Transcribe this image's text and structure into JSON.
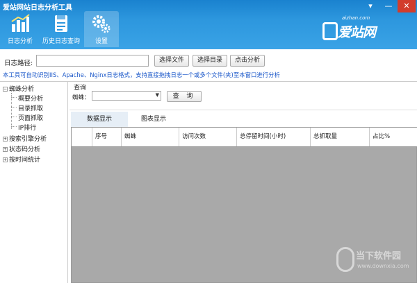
{
  "window": {
    "title": "爱站网站日志分析工具",
    "controls": {
      "menu": "▾",
      "minimize": "—",
      "close": "✕"
    }
  },
  "ribbon": {
    "tools": [
      {
        "label": "日志分析",
        "icon": "bar-chart-icon"
      },
      {
        "label": "历史日志查询",
        "icon": "document-icon"
      },
      {
        "label": "设置",
        "icon": "gears-icon"
      }
    ],
    "logo": {
      "url": "aizhan.com",
      "text": "爱站网"
    }
  },
  "path_bar": {
    "label": "日志路径:",
    "value": "",
    "buttons": {
      "select_file": "选择文件",
      "select_dir": "选择目录",
      "analyze": "点击分析"
    },
    "notice": "本工具可自动识别IIS、Apache、Nginx日志格式，支持直接拖拽日志一个或多个文件(夹)至本窗口进行分析"
  },
  "tree": {
    "root": "蜘蛛分析",
    "children": [
      "概要分析",
      "目录抓取",
      "页面抓取",
      "IP排行"
    ],
    "others": [
      "搜索引擎分析",
      "状态码分析",
      "按时间统计"
    ]
  },
  "query": {
    "title": "查询",
    "spider_label": "蜘蛛：",
    "spider_value": "",
    "button": "查 询"
  },
  "tabs": {
    "data": "数据显示",
    "chart": "图表显示"
  },
  "table": {
    "headers": [
      "序号",
      "蜘蛛",
      "访问次数",
      "总停留时间(小时)",
      "总抓取量",
      "占比%"
    ]
  },
  "watermark": {
    "text": "当下软件园",
    "url": "www.downxia.com"
  }
}
